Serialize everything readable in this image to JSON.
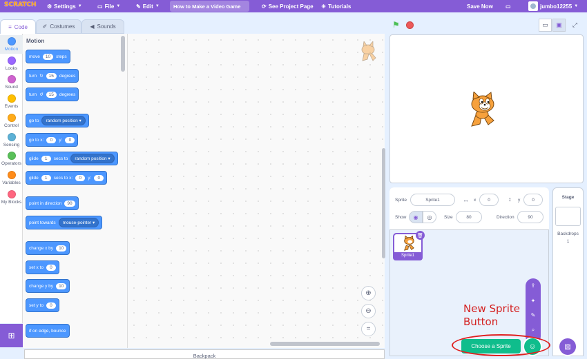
{
  "menubar": {
    "logo": "SCRATCH",
    "settings": "Settings",
    "file": "File",
    "edit": "Edit",
    "project_title": "How to Make a Video Game",
    "see_project_page": "See Project Page",
    "tutorials": "Tutorials",
    "save_now": "Save Now",
    "username": "jumbo12255",
    "color": "#855cd6"
  },
  "tabs": {
    "code": "Code",
    "costumes": "Costumes",
    "sounds": "Sounds"
  },
  "categories": [
    {
      "label": "Motion",
      "color": "#4c97ff"
    },
    {
      "label": "Looks",
      "color": "#9966ff"
    },
    {
      "label": "Sound",
      "color": "#cf63cf"
    },
    {
      "label": "Events",
      "color": "#ffbf00"
    },
    {
      "label": "Control",
      "color": "#ffab19"
    },
    {
      "label": "Sensing",
      "color": "#5cb1d6"
    },
    {
      "label": "Operators",
      "color": "#59c059"
    },
    {
      "label": "Variables",
      "color": "#ff8c1a"
    },
    {
      "label": "My Blocks",
      "color": "#ff6680"
    }
  ],
  "palette": {
    "title": "Motion",
    "move": {
      "a": "move",
      "v": "10",
      "b": "steps"
    },
    "turn_right": {
      "a": "turn",
      "v": "15",
      "b": "degrees"
    },
    "turn_left": {
      "a": "turn",
      "v": "15",
      "b": "degrees"
    },
    "go_to": {
      "a": "go to",
      "d": "random position"
    },
    "go_to_xy": {
      "a": "go to x:",
      "x": "0",
      "b": "y:",
      "y": "0"
    },
    "glide_to": {
      "a": "glide",
      "v": "1",
      "b": "secs to",
      "d": "random position"
    },
    "glide_xy": {
      "a": "glide",
      "v": "1",
      "b": "secs to x:",
      "x": "0",
      "c": "y:",
      "y": "0"
    },
    "point_dir": {
      "a": "point in direction",
      "v": "90"
    },
    "point_towards": {
      "a": "point towards",
      "d": "mouse-pointer"
    },
    "change_x": {
      "a": "change x by",
      "v": "10"
    },
    "set_x": {
      "a": "set x to",
      "v": "0"
    },
    "change_y": {
      "a": "change y by",
      "v": "10"
    },
    "set_y": {
      "a": "set y to",
      "v": "0"
    },
    "bounce": {
      "a": "if on edge, bounce"
    }
  },
  "backpack": "Backpack",
  "sprite_info": {
    "sprite_label": "Sprite",
    "sprite_name": "Sprite1",
    "x_label": "x",
    "x": "0",
    "y_label": "y",
    "y": "0",
    "show_label": "Show",
    "size_label": "Size",
    "size": "80",
    "direction_label": "Direction",
    "direction": "90"
  },
  "sprite_list": [
    {
      "name": "Sprite1"
    }
  ],
  "stage_pane": {
    "title": "Stage",
    "backdrops_label": "Backdrops",
    "backdrops_count": "1"
  },
  "choose_sprite": "Choose a Sprite",
  "annotation": {
    "line1": "New Sprite",
    "line2": "Button"
  }
}
